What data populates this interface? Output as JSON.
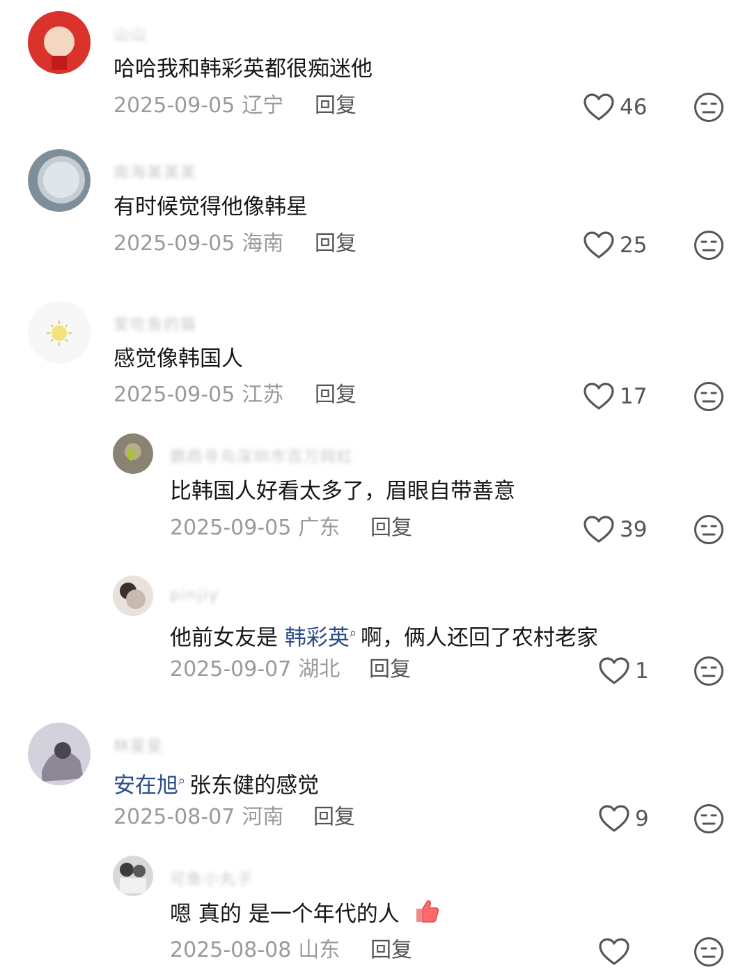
{
  "reply_label": "回复",
  "comments": [
    {
      "username": "山山",
      "text": "哈哈我和韩彩英都很痴迷他",
      "date": "2025-09-05",
      "location": "辽宁",
      "likes": "46",
      "avatar_color": "#d9332b"
    },
    {
      "username": "南海某某某",
      "text": "有时候觉得他像韩星",
      "date": "2025-09-05",
      "location": "海南",
      "likes": "25",
      "avatar_color": "#8fa3b0"
    },
    {
      "username": "爱吃鱼的猫",
      "text": "感觉像韩国人",
      "date": "2025-09-05",
      "location": "江苏",
      "likes": "17",
      "avatar_color": "#f4f4f4",
      "replies": [
        {
          "username": "鹦鹉寻鸟深圳市百万网红",
          "text": "比韩国人好看太多了，眉眼自带善意",
          "date": "2025-09-05",
          "location": "广东",
          "likes": "39",
          "avatar_color": "#8a8272"
        },
        {
          "username": "pinjiy",
          "text_prefix": "他前女友是 ",
          "mention": "韩彩英",
          "text_suffix": "啊，俩人还回了农村老家",
          "date": "2025-09-07",
          "location": "湖北",
          "likes": "1",
          "avatar_color": "#c9b8ae"
        }
      ]
    },
    {
      "username": "林星星",
      "mention": "安在旭",
      "text_suffix": "张东健的感觉",
      "date": "2025-08-07",
      "location": "河南",
      "likes": "9",
      "avatar_color": "#a8a6b4",
      "replies": [
        {
          "username": "可鱼小丸子",
          "text": "嗯 真的 是一个年代的人",
          "emoji": "thumbs-up",
          "date": "2025-08-08",
          "location": "山东",
          "likes": "",
          "avatar_color": "#bfbfbf"
        }
      ]
    }
  ],
  "colors": {
    "mention": "#2a4c86",
    "meta": "#9a9a9a",
    "icon": "#555555"
  }
}
